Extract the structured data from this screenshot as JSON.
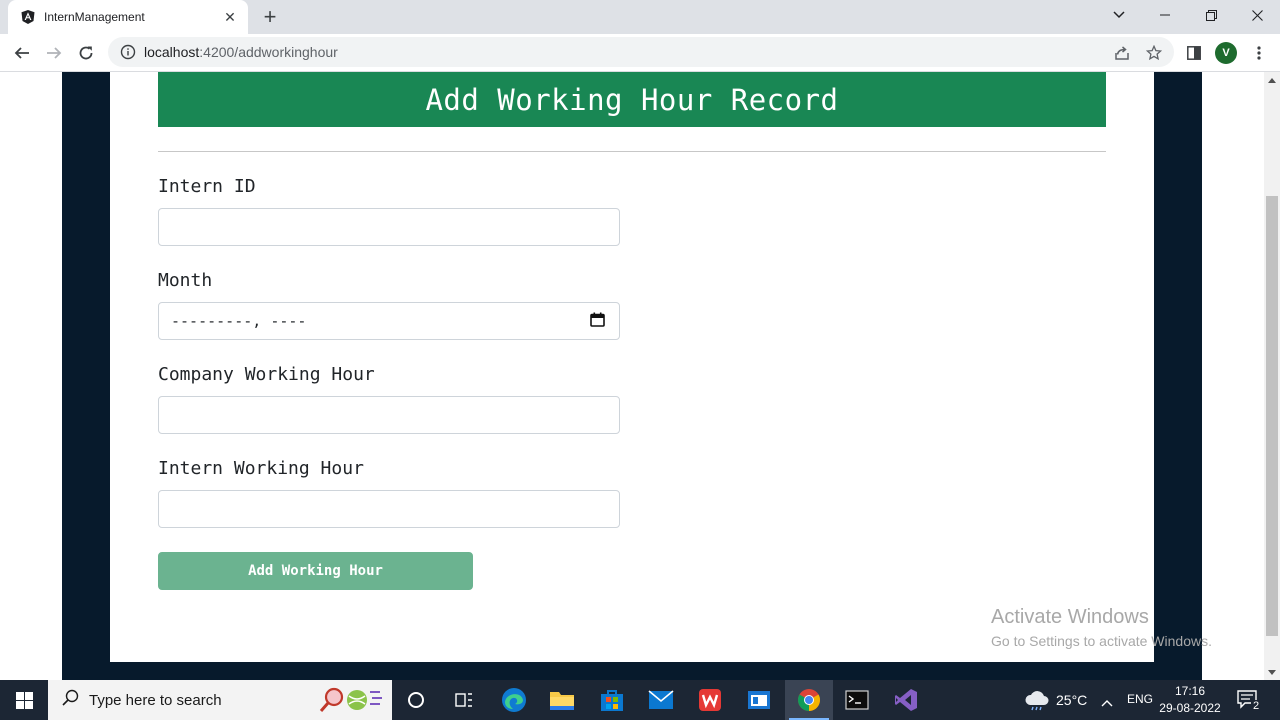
{
  "browser": {
    "tab_title": "InternManagement",
    "url_host": "localhost",
    "url_path": ":4200/addworkinghour",
    "profile_initial": "V"
  },
  "page": {
    "header_title": "Add Working Hour Record",
    "fields": {
      "intern_id_label": "Intern ID",
      "intern_id_value": "",
      "month_label": "Month",
      "month_placeholder": "---------, ----",
      "company_hour_label": "Company Working Hour",
      "company_hour_value": "",
      "intern_hour_label": "Intern Working Hour",
      "intern_hour_value": ""
    },
    "submit_label": "Add Working Hour"
  },
  "watermark": {
    "title": "Activate Windows",
    "subtitle": "Go to Settings to activate Windows."
  },
  "taskbar": {
    "search_placeholder": "Type here to search",
    "weather_temp": "25°C",
    "language": "ENG",
    "time": "17:16",
    "date": "29-08-2022",
    "notification_count": "2"
  },
  "colors": {
    "header_green": "#198754",
    "button_green": "#6bb390",
    "dark_band": "#071a2c",
    "taskbar": "#1c2634"
  }
}
